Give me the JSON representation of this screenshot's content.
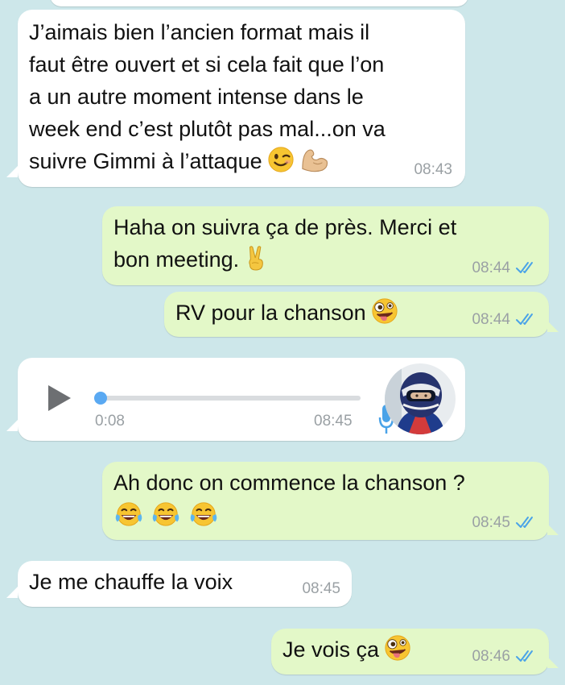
{
  "messages": [
    {
      "id": "m0",
      "type": "text",
      "direction": "in",
      "lines": []
    },
    {
      "id": "m1",
      "type": "text",
      "direction": "in",
      "lines": [
        "J’aimais bien l’ancien format mais il",
        "faut être ouvert et si cela fait que l’on",
        "a un autre moment intense dans le",
        "week end c’est plutôt pas mal...on va",
        "suivre Gimmi à l’attaque"
      ],
      "emojis": [
        "wink-face-emoji",
        "flexed-biceps-emoji"
      ],
      "time": "08:43"
    },
    {
      "id": "m2",
      "type": "text",
      "direction": "out",
      "lines": [
        "Haha on suivra ça de près. Merci et",
        "bon meeting."
      ],
      "emojis": [
        "victory-hand-emoji"
      ],
      "time": "08:44",
      "status": "read"
    },
    {
      "id": "m3",
      "type": "text",
      "direction": "out",
      "lines": [
        "RV pour la chanson"
      ],
      "emojis": [
        "zany-face-emoji"
      ],
      "time": "08:44",
      "status": "read"
    },
    {
      "id": "m4",
      "type": "voice",
      "direction": "in",
      "duration": "0:08",
      "progress": 0.0,
      "time": "08:45",
      "icons": [
        "play-icon",
        "microphone-icon",
        "sender-avatar"
      ]
    },
    {
      "id": "m5",
      "type": "text",
      "direction": "out",
      "lines": [
        "Ah donc on commence la chanson ?"
      ],
      "emojis": [
        "tears-of-joy-emoji",
        "tears-of-joy-emoji",
        "tears-of-joy-emoji"
      ],
      "time": "08:45",
      "status": "read"
    },
    {
      "id": "m6",
      "type": "text",
      "direction": "in",
      "lines": [
        "Je me chauffe la voix"
      ],
      "time": "08:45"
    },
    {
      "id": "m7",
      "type": "text",
      "direction": "out",
      "lines": [
        "Je vois ça"
      ],
      "emojis": [
        "zany-face-emoji"
      ],
      "time": "08:46",
      "status": "read"
    }
  ],
  "colors": {
    "background": "#cde7ea",
    "incoming": "#ffffff",
    "outgoing": "#e3f8c8",
    "read_ticks": "#4aa3e8",
    "accent": "#5aa9f2"
  }
}
